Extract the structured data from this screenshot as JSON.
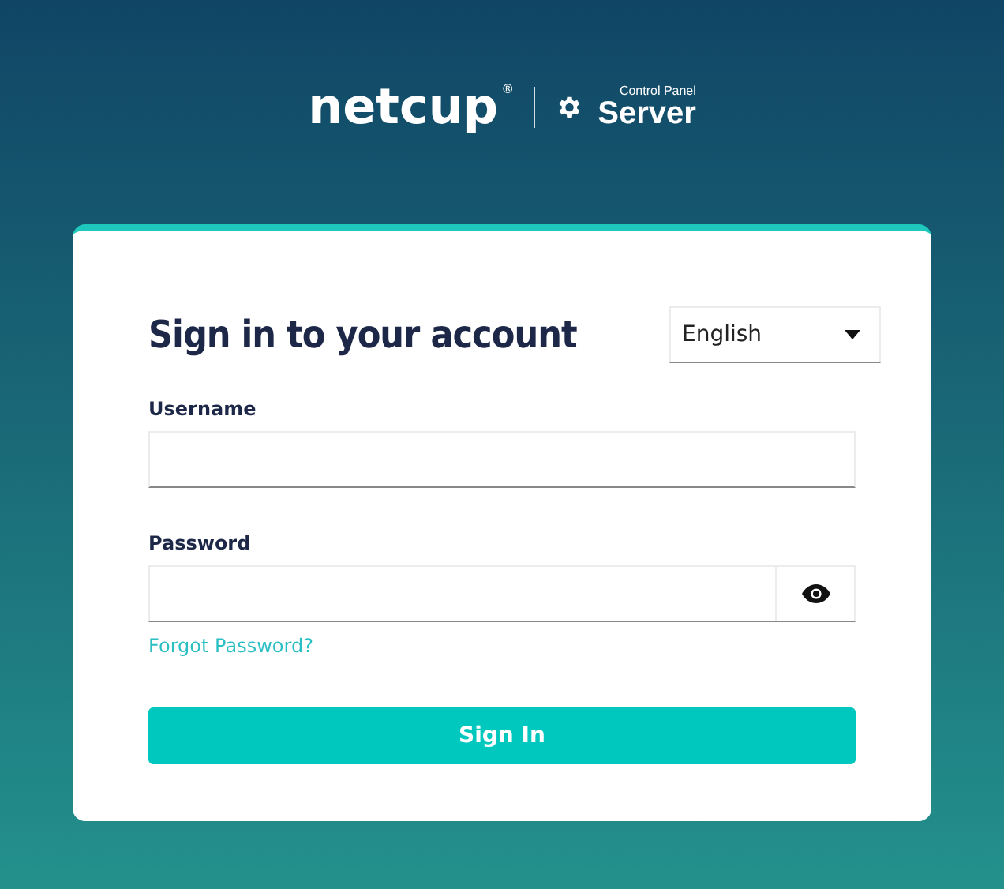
{
  "logo": {
    "brand": "netcup",
    "registered": "®",
    "subtitle": "Control Panel",
    "product": "Server"
  },
  "form": {
    "title": "Sign in to your account",
    "language": "English",
    "fields": [
      {
        "label": "Username",
        "kind": "text"
      },
      {
        "label": "Password",
        "kind": "password"
      }
    ],
    "forgot_link": "Forgot Password?",
    "submit": "Sign In"
  }
}
